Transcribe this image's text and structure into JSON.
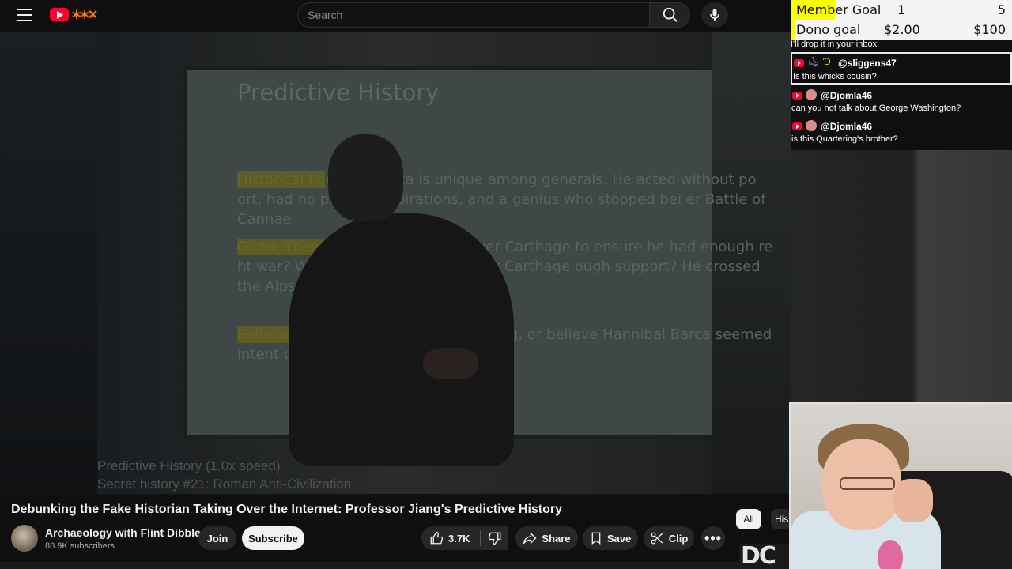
{
  "header": {
    "search_placeholder": "Search",
    "icons": [
      "menu-icon",
      "youtube-logo",
      "search-icon",
      "microphone-icon"
    ]
  },
  "video": {
    "slide": {
      "title": "Predictive History",
      "p1_highlight": "Historical Po",
      "p1_text": "nnibal Barca is unique among generals.  He acted without po        ort, had no political aspirations, and a genius who stopped bei        er Battle of Cannae",
      "p2_highlight": "Game Theory",
      "p2_text": "dn't Hannibal take over Carthage to ensure he had enough re        ht war?  Why didn't he march against Carthage           ough support? He crossed the Alps on his own",
      "p3_highlight": "Religion",
      "p3_text": "uerors have a messianic calling, or believe              Hannibal Barca seemed intent on vengea"
    },
    "caption_line1": "Predictive History (1.0x speed)",
    "caption_line2": "Secret history #21: Roman Anti-Civilization"
  },
  "info": {
    "title": "Debunking the Fake Historian Taking Over the Internet: Professor Jiang's Predictive History",
    "channel_name": "Archaeology with Flint Dibble",
    "subscribers": "88.9K subscribers",
    "join_label": "Join",
    "subscribe_label": "Subscribe",
    "like_count": "3.7K",
    "share_label": "Share",
    "save_label": "Save",
    "clip_label": "Clip",
    "more_icon": "more-icon"
  },
  "chips": {
    "all": "All",
    "history": "His"
  },
  "overlay": {
    "member_goal": {
      "label": "Member Goal",
      "current": "1",
      "target": "5",
      "progress": 0.2
    },
    "dono_goal": {
      "label": "Dono goal",
      "current": "$2.00",
      "target": "$100",
      "progress": 0.02
    },
    "chat": {
      "clipped_text": "I'll drop it in your inbox",
      "messages": [
        {
          "user": "@sliggens47",
          "text": "Is this whicks cousin?"
        },
        {
          "user": "@Djomla46",
          "text": "can you not talk about George Washington?"
        },
        {
          "user": "@Djomla46",
          "text": "is this Quartering's brother?"
        }
      ]
    },
    "brand_mark": "DC"
  }
}
